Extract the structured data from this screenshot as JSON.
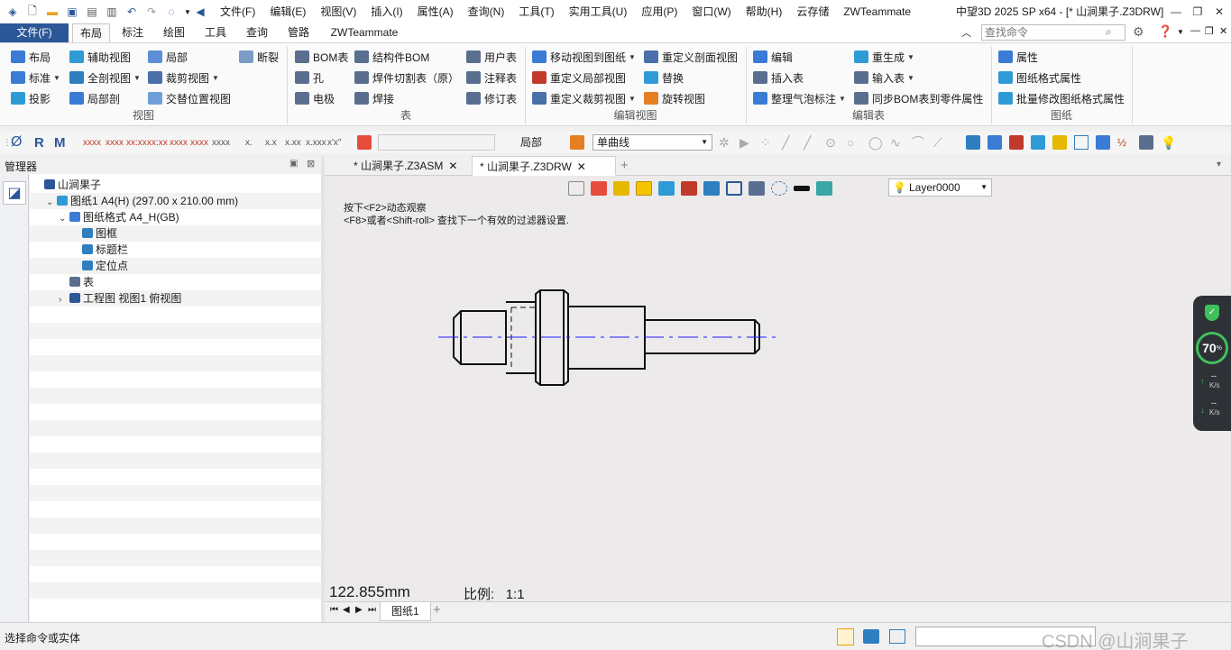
{
  "titlebar": {
    "menus": [
      "文件(F)",
      "编辑(E)",
      "视图(V)",
      "插入(I)",
      "属性(A)",
      "查询(N)",
      "工具(T)",
      "实用工具(U)",
      "应用(P)",
      "窗口(W)",
      "帮助(H)",
      "云存储",
      "ZWTeammate"
    ],
    "title": "中望3D 2025 SP x64 - [* 山涧果子.Z3DRW]"
  },
  "ribbon_tabs": {
    "file": "文件(F)",
    "tabs": [
      "布局",
      "标注",
      "绘图",
      "工具",
      "查询",
      "管路",
      "ZWTeammate"
    ],
    "search_placeholder": "查找命令"
  },
  "ribbon": {
    "view": {
      "group": "视图",
      "items": [
        "布局",
        "辅助视图",
        "局部",
        "断裂",
        "标准",
        "全剖视图",
        "裁剪视图",
        "投影",
        "局部剖",
        "交替位置视图"
      ]
    },
    "table": {
      "group": "表",
      "items": [
        "BOM表",
        "结构件BOM",
        "用户表",
        "孔",
        "焊件切割表（原）",
        "注释表",
        "电极",
        "焊接",
        "修订表"
      ]
    },
    "edit_view": {
      "group": "编辑视图",
      "items": [
        "移动视图到图纸",
        "重定义剖面视图",
        "重定义局部视图",
        "替换",
        "重定义裁剪视图",
        "旋转视图"
      ]
    },
    "edit_table": {
      "group": "编辑表",
      "items": [
        "编辑",
        "重生成",
        "插入表",
        "输入表",
        "整理气泡标注",
        "同步BOM表到零件属性"
      ]
    },
    "drawing": {
      "group": "图纸",
      "items": [
        "属性",
        "图纸格式属性",
        "批量修改图纸格式属性"
      ]
    }
  },
  "toolbar2": {
    "filter_label": "局部",
    "curve_mode": "单曲线",
    "dim_icons": [
      "x.xxxx",
      "x.xxx",
      "x.xx",
      "x.x",
      "x"
    ]
  },
  "manager": {
    "title": "管理器",
    "tree": [
      {
        "label": "山涧果子",
        "level": 0,
        "icon": "part-icon"
      },
      {
        "label": "图纸1 A4(H) (297.00 x 210.00 mm)",
        "level": 1,
        "icon": "sheet-icon",
        "expanded": true
      },
      {
        "label": "图纸格式 A4_H(GB)",
        "level": 2,
        "icon": "format-icon",
        "expanded": true
      },
      {
        "label": "图框",
        "level": 3,
        "icon": "frame-icon"
      },
      {
        "label": "标题栏",
        "level": 3,
        "icon": "titleblock-icon"
      },
      {
        "label": "定位点",
        "level": 3,
        "icon": "anchor-icon"
      },
      {
        "label": "表",
        "level": 2,
        "icon": "table-icon"
      },
      {
        "label": "工程图 视图1 俯视图",
        "level": 2,
        "icon": "view-icon",
        "expanded": false
      }
    ]
  },
  "doc_tabs": [
    "* 山涧果子.Z3ASM",
    "* 山涧果子.Z3DRW"
  ],
  "canvas": {
    "layer": "Layer0000",
    "hint1": "按下<F2>动态观察",
    "hint2": "<F8>或者<Shift-roll> 查找下一个有效的过滤器设置.",
    "coordinate": "122.855mm",
    "scale_label": "比例:",
    "scale_value": "1:1"
  },
  "sheet_tabs": [
    "图纸1"
  ],
  "status": {
    "text": "选择命令或实体",
    "watermark": "CSDN @山涧果子"
  },
  "perf_widget": {
    "percent": "70",
    "percent_unit": "%",
    "up_value": "--",
    "up_unit": "K/s",
    "down_value": "--",
    "down_unit": "K/s"
  },
  "colors": {
    "file_tab": "#2b5797",
    "centerline": "#1a1aff",
    "perf_ring": "#3fbf5c"
  }
}
